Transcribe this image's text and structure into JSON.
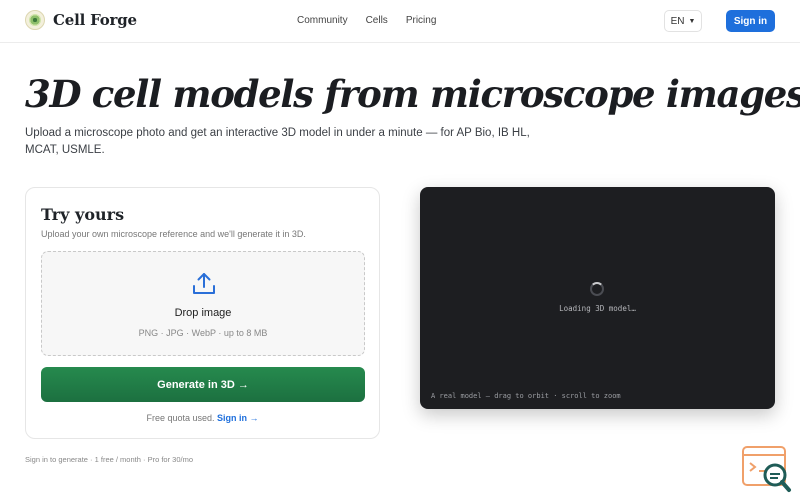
{
  "nav": {
    "brand": "Cell Forge",
    "links": [
      "Community",
      "Cells",
      "Pricing"
    ],
    "language": "EN",
    "signin_label": "Sign in"
  },
  "hero": {
    "title": "3D cell models from microscope images.",
    "subtitle": "Upload a microscope photo and get an interactive 3D model in under a minute — for AP Bio, IB HL, MCAT, USMLE."
  },
  "upload_card": {
    "title": "Try yours",
    "description": "Upload your own microscope reference and we'll generate it in 3D.",
    "drop_title": "Drop image",
    "drop_hint": "PNG · JPG · WebP · up to 8 MB",
    "generate_label": "Generate in 3D →",
    "quota_text": "Free quota used.",
    "quota_link": "Sign in →"
  },
  "footnote": "Sign in to generate · 1 free / month · Pro for 30/mo",
  "viewer": {
    "loading_text": "Loading 3D model…",
    "caption": "A real model — drag to orbit · scroll to zoom"
  },
  "colors": {
    "accent_blue": "#1e6fdc",
    "generate_green": "#268a4e",
    "viewer_bg": "#1d1e21"
  },
  "icons": {
    "brand": "cell-logo-icon",
    "upload": "upload-icon",
    "language_chevron": "chevron-down-icon",
    "spinner": "loading-spinner-icon",
    "widget": "search-document-icon"
  }
}
